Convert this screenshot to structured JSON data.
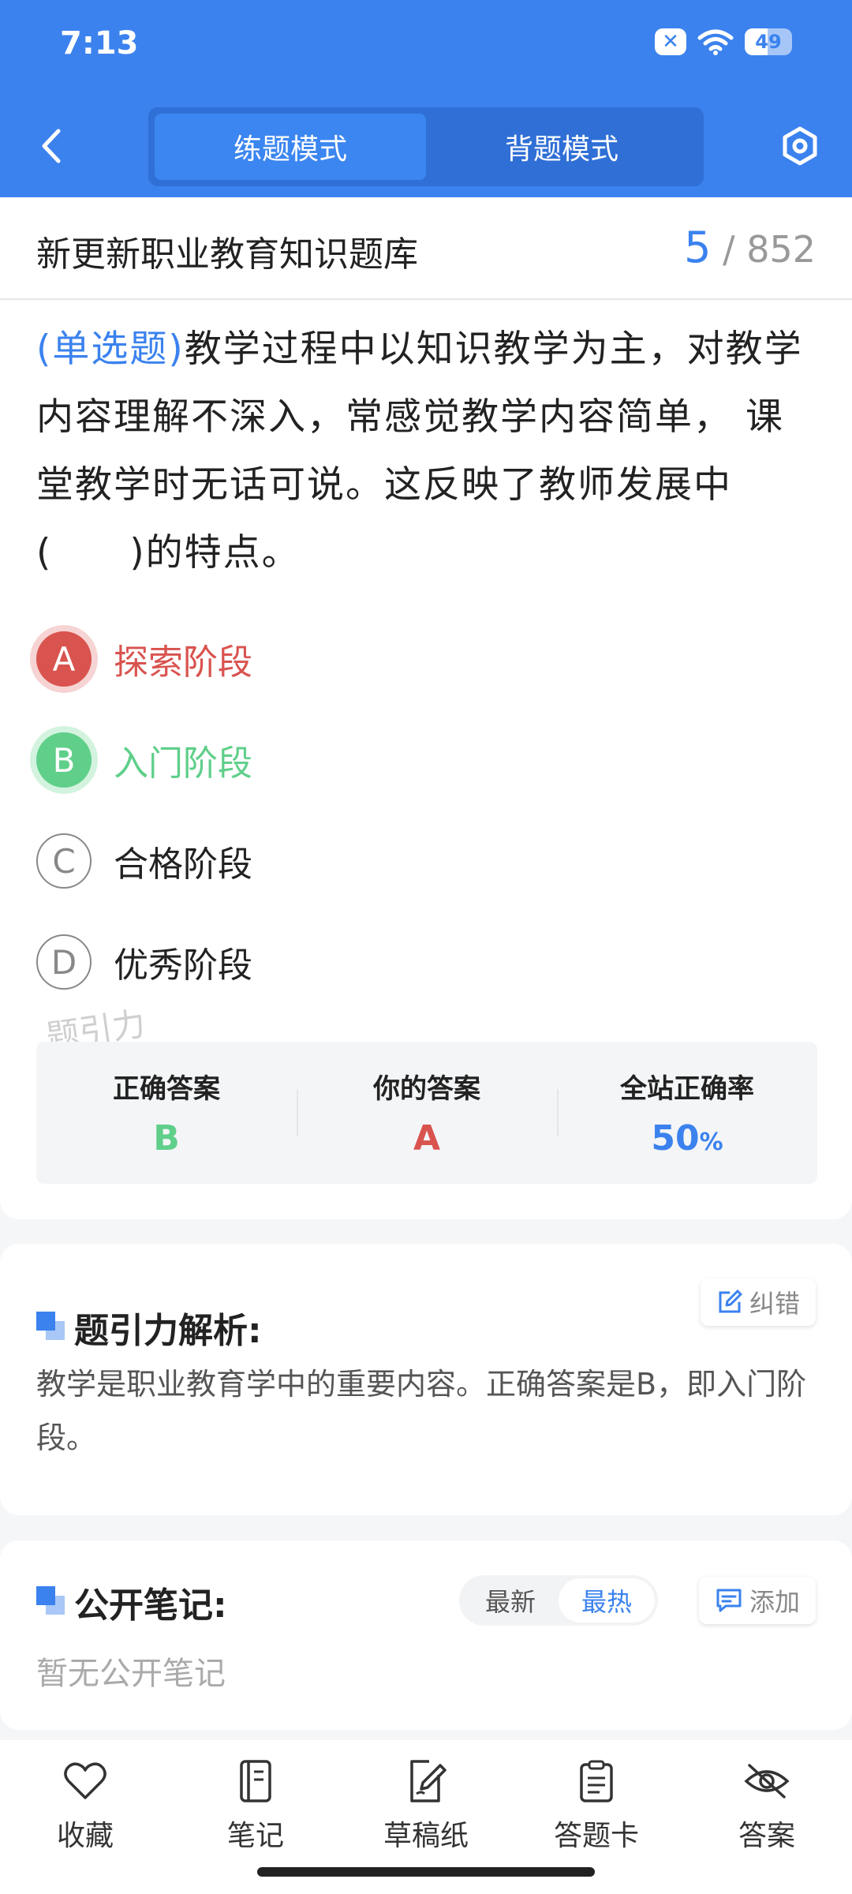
{
  "status_bar": {
    "time": "7:13",
    "battery": "49",
    "battery_level": 0.49
  },
  "header": {
    "tabs": [
      {
        "label": "练题模式",
        "active": true
      },
      {
        "label": "背题模式",
        "active": false
      }
    ]
  },
  "quiz": {
    "bank_title": "新更新职业教育知识题库",
    "current": "5",
    "total": "/ 852",
    "question_type": "(单选题)",
    "question_text": "教学过程中以知识教学为主，对教学内容理解不深入，常感觉教学内容简单， 课堂教学时无话可说。这反映了教师发展中(　　)的特点。",
    "options": [
      {
        "letter": "A",
        "text": "探索阶段",
        "state": "wrong"
      },
      {
        "letter": "B",
        "text": "入门阶段",
        "state": "correct"
      },
      {
        "letter": "C",
        "text": "合格阶段",
        "state": "normal"
      },
      {
        "letter": "D",
        "text": "优秀阶段",
        "state": "normal"
      }
    ],
    "watermark": "题引力"
  },
  "stats": {
    "correct_label": "正确答案",
    "correct_value": "B",
    "yours_label": "你的答案",
    "yours_value": "A",
    "rate_label": "全站正确率",
    "rate_value": "50",
    "rate_unit": "%"
  },
  "analysis": {
    "title": "题引力解析:",
    "correct_button": "纠错",
    "text": "教学是职业教育学中的重要内容。正确答案是B，即入门阶段。"
  },
  "notes": {
    "title": "公开笔记:",
    "sort_options": [
      "最新",
      "最热"
    ],
    "sort_active": "最热",
    "add_button": "添加",
    "empty_text": "暂无公开笔记"
  },
  "bottom_bar": [
    {
      "label": "收藏",
      "icon": "heart-icon"
    },
    {
      "label": "笔记",
      "icon": "notebook-icon"
    },
    {
      "label": "草稿纸",
      "icon": "draft-paper-icon"
    },
    {
      "label": "答题卡",
      "icon": "answer-sheet-icon"
    },
    {
      "label": "答案",
      "icon": "eye-off-icon"
    }
  ],
  "colors": {
    "primary": "#3b82ee",
    "correct": "#5fcf8a",
    "wrong": "#d9534f"
  }
}
